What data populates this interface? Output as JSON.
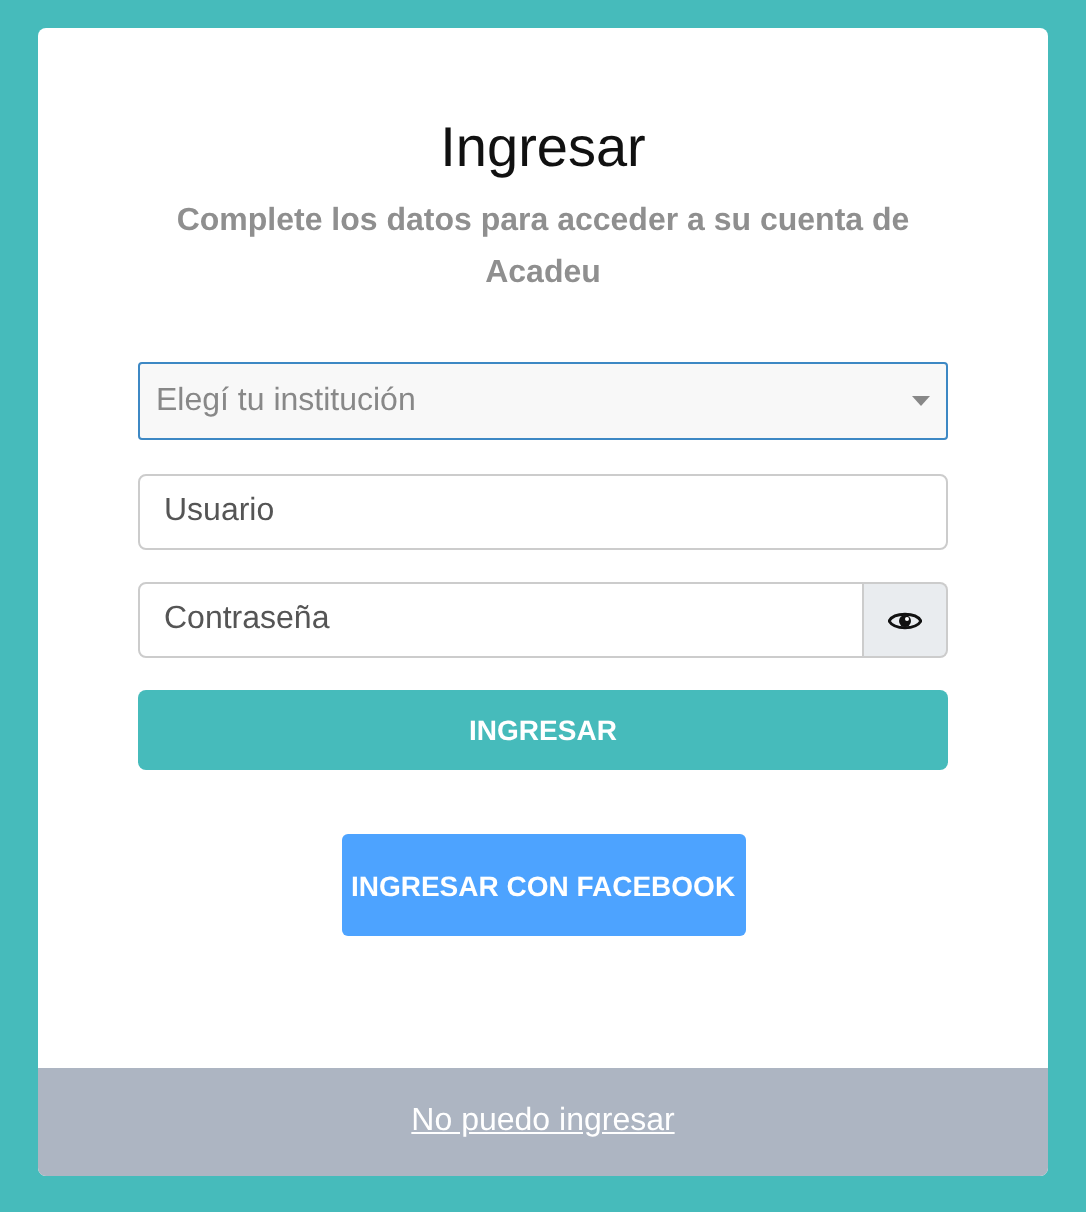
{
  "title": "Ingresar",
  "subtitle": "Complete los datos para acceder a su cuenta de Acadeu",
  "institution_select": {
    "placeholder": "Elegí tu institución"
  },
  "username": {
    "placeholder": "Usuario"
  },
  "password": {
    "placeholder": "Contraseña"
  },
  "login_button": "INGRESAR",
  "facebook_button": "INGRESAR CON FACEBOOK",
  "footer_link": "No puedo ingresar"
}
